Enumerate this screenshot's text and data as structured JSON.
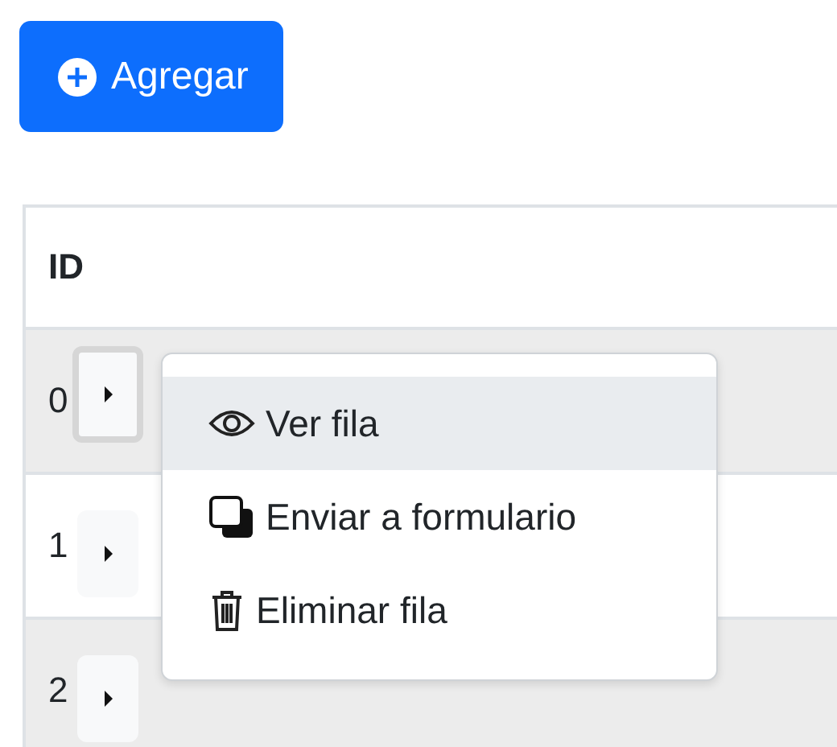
{
  "add_button": {
    "label": "Agregar"
  },
  "table": {
    "columns": [
      "ID"
    ],
    "rows": [
      {
        "id": "0",
        "focused": true
      },
      {
        "id": "1",
        "focused": false
      },
      {
        "id": "2",
        "focused": false
      }
    ]
  },
  "row_menu": {
    "items": [
      {
        "label": "Ver fila",
        "kind": "view",
        "selected": true
      },
      {
        "label": "Enviar a formulario",
        "kind": "send",
        "selected": false
      },
      {
        "label": "Eliminar fila",
        "kind": "delete",
        "selected": false
      }
    ]
  }
}
